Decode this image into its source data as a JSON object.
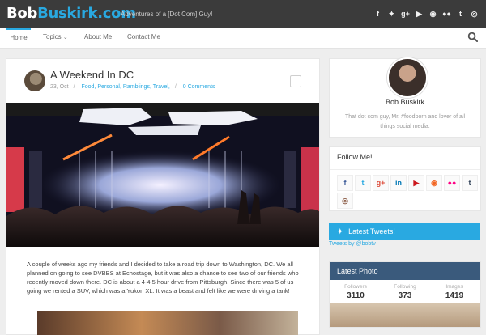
{
  "header": {
    "logo_part1": "Bob",
    "logo_part2": "Buskirk.com",
    "tagline": "Adventures of a [Dot Com] Guy!",
    "social_icons": [
      "facebook-icon",
      "twitter-icon",
      "google-plus-icon",
      "youtube-icon",
      "rss-icon",
      "flickr-icon",
      "tumblr-icon",
      "instagram-icon"
    ]
  },
  "nav": {
    "items": [
      {
        "label": "Home"
      },
      {
        "label": "Topics"
      },
      {
        "label": "About Me"
      },
      {
        "label": "Contact Me"
      }
    ]
  },
  "post": {
    "title": "A Weekend In DC",
    "date": "23, Oct",
    "categories": [
      "Food,",
      "Personal,",
      "Ramblings,",
      "Travel,"
    ],
    "comments": "0 Comments",
    "body": "A couple of weeks ago my friends and I decided to take a road trip down to Washington, DC.   We all planned on going to see DVBBS at Echostage, but it was also a chance to see two of our friends who recently moved down there.       DC is about a 4-4.5 hour drive from Pittsburgh.    Since there was 5 of us going we rented a SUV, which was a Yukon XL.   It was a beast and felt like we were driving a tank!"
  },
  "sidebar": {
    "profile": {
      "name": "Bob Buskirk",
      "bio": "That dot com guy, Mr. #foodporn and lover of all things social media."
    },
    "follow": {
      "title": "Follow Me!",
      "icons": [
        {
          "name": "facebook-icon",
          "glyph": "f",
          "color": "#3b5998"
        },
        {
          "name": "twitter-icon",
          "glyph": "t",
          "color": "#29a9e1"
        },
        {
          "name": "google-plus-icon",
          "glyph": "g+",
          "color": "#dd4b39"
        },
        {
          "name": "linkedin-icon",
          "glyph": "in",
          "color": "#0077b5"
        },
        {
          "name": "youtube-icon",
          "glyph": "▶",
          "color": "#cc181e"
        },
        {
          "name": "rss-icon",
          "glyph": "◉",
          "color": "#f26522"
        },
        {
          "name": "flickr-icon",
          "glyph": "●●",
          "color": "#ff0084"
        },
        {
          "name": "tumblr-icon",
          "glyph": "t",
          "color": "#35465c"
        },
        {
          "name": "instagram-icon",
          "glyph": "◎",
          "color": "#8a5a44"
        }
      ]
    },
    "tweets": {
      "title": "Latest Tweets!",
      "link": "Tweets by @bobtv"
    },
    "latest_photo": {
      "title": "Latest Photo",
      "stats": [
        {
          "label": "Followers",
          "value": "3110"
        },
        {
          "label": "Following",
          "value": "373"
        },
        {
          "label": "Images",
          "value": "1419"
        }
      ]
    }
  }
}
